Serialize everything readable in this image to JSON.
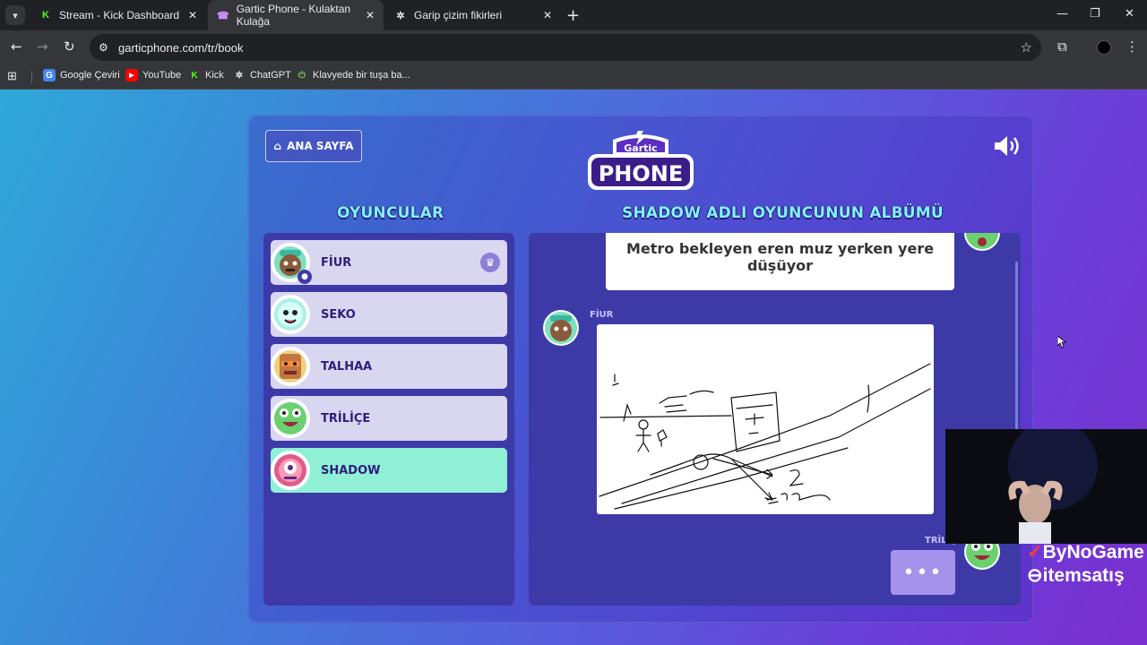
{
  "browser": {
    "tabs": [
      {
        "title": "Stream - Kick Dashboard",
        "icon": "kick-icon"
      },
      {
        "title": "Gartic Phone - Kulaktan Kulağa",
        "icon": "phone-icon"
      },
      {
        "title": "Garip çizim fikirleri",
        "icon": "chatgpt-icon"
      }
    ],
    "url": "garticphone.com/tr/book",
    "bookmarks": [
      {
        "label": "Google Çeviri"
      },
      {
        "label": "YouTube"
      },
      {
        "label": "Kick"
      },
      {
        "label": "ChatGPT"
      },
      {
        "label": "Klavyede bir tuşa ba..."
      }
    ]
  },
  "game": {
    "home_label": "ANA SAYFA",
    "logo_top": "Gartic",
    "logo_bottom": "PHONE",
    "players_heading": "OYUNCULAR",
    "album_heading": "SHADOW ADLI OYUNCUNUN ALBÜMÜ",
    "players": [
      {
        "name": "FİUR",
        "host": true
      },
      {
        "name": "SEKO"
      },
      {
        "name": "TALHAA"
      },
      {
        "name": "TRİLİÇE"
      },
      {
        "name": "SHADOW",
        "active": true
      }
    ],
    "album": {
      "caption": "Metro bekleyen eren muz yerken yere düşüyor",
      "drawing_author": "FİUR",
      "next_author": "TRİLİÇE",
      "typing": "•••"
    }
  },
  "overlay": {
    "sponsor_1": "ByNoGame",
    "sponsor_2": "itemsatış"
  },
  "colors": {
    "heading": "#7ff3ff",
    "active_player": "#8ff0d6",
    "panel": "#3d3aa8"
  }
}
